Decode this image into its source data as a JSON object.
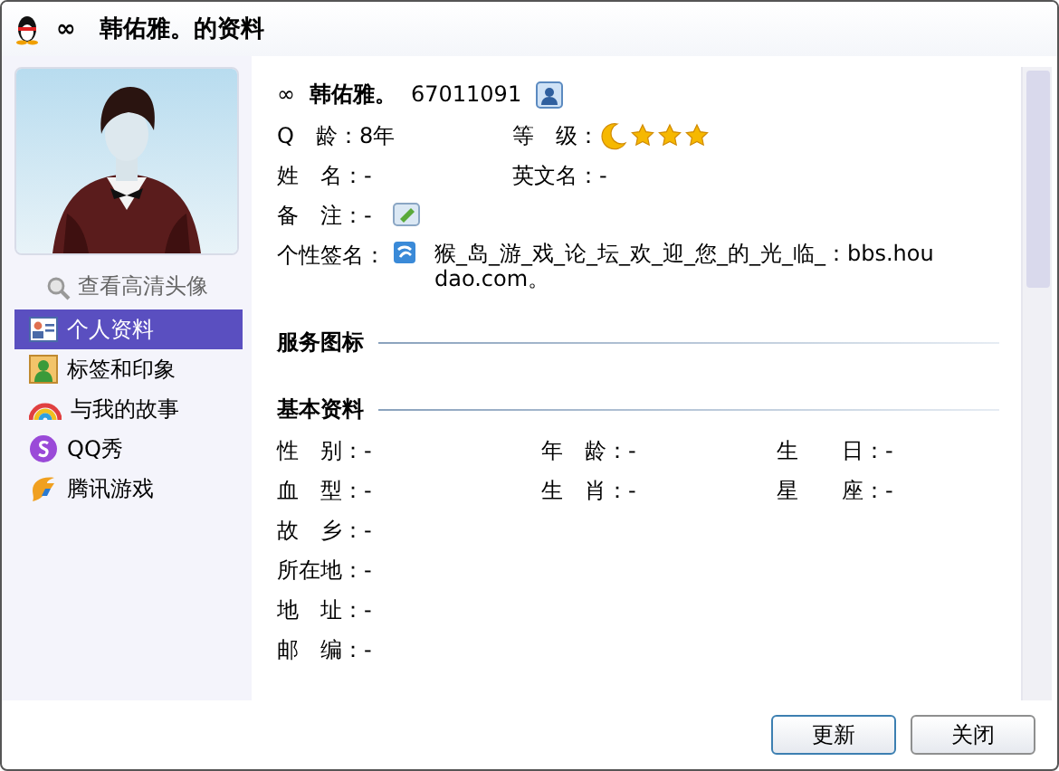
{
  "window": {
    "title": "∞　韩佑雅。的资料"
  },
  "sidebar": {
    "avatar_link": "查看高清头像",
    "items": [
      {
        "label": "个人资料",
        "kind": "card",
        "selected": true
      },
      {
        "label": "标签和印象",
        "kind": "person",
        "selected": false
      },
      {
        "label": "与我的故事",
        "kind": "rainbow",
        "selected": false
      },
      {
        "label": "QQ秀",
        "kind": "show",
        "selected": false
      },
      {
        "label": "腾讯游戏",
        "kind": "game",
        "selected": false
      }
    ]
  },
  "profile": {
    "prefix": "∞",
    "nickname": "韩佑雅。",
    "number": "67011091",
    "rows": [
      [
        {
          "text": "Q　龄：8年"
        },
        {
          "text": "等　级：",
          "stars": 3
        }
      ],
      [
        {
          "text": "姓　名：-"
        },
        {
          "text": "英文名：-"
        }
      ],
      [
        {
          "text": "备　注：-",
          "editable": true
        }
      ]
    ],
    "signature_label": "个性签名：",
    "signature": "猴_岛_游_戏_论_坛_欢_迎_您_的_光_临_：bbs.houdao.com。"
  },
  "sections": [
    {
      "title": "服务图标"
    },
    {
      "title": "基本资料",
      "rows": [
        [
          {
            "text": "性　别：-"
          },
          {
            "text": "年　龄：-"
          },
          {
            "text": "生　　日：-"
          }
        ],
        [
          {
            "text": "血　型：-"
          },
          {
            "text": "生　肖：-"
          },
          {
            "text": "星　　座：-"
          }
        ],
        [
          {
            "text": "故　乡：-"
          }
        ],
        [
          {
            "text": "所在地：-"
          }
        ],
        [
          {
            "text": "地　址：-"
          }
        ],
        [
          {
            "text": "邮　编：-"
          }
        ]
      ]
    }
  ],
  "buttons": [
    "更新",
    "关闭"
  ]
}
